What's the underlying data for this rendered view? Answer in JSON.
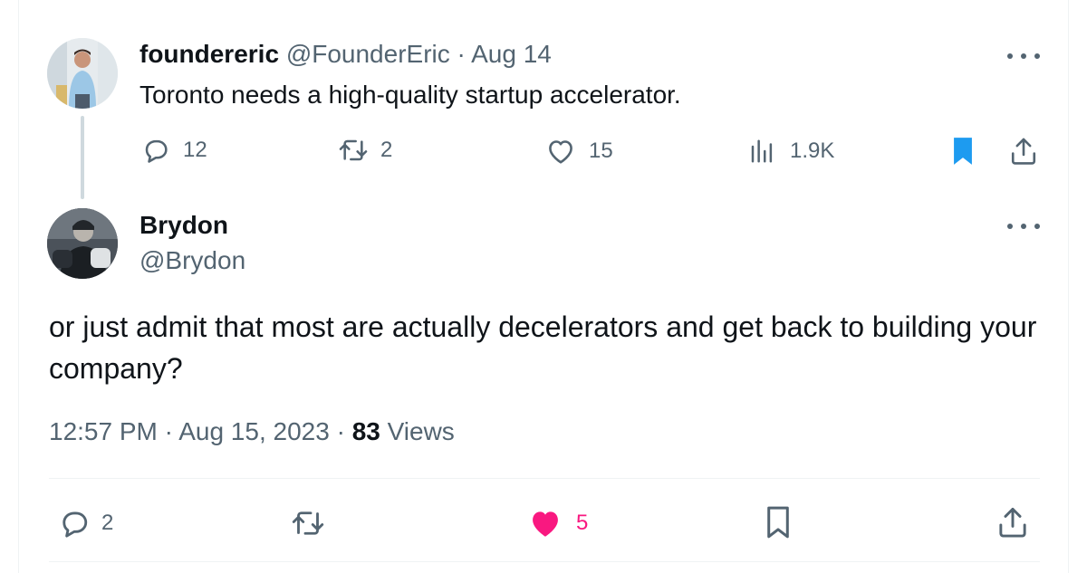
{
  "parent_tweet": {
    "display_name": "foundereric",
    "handle": "@FounderEric",
    "separator": "·",
    "date": "Aug 14",
    "text": "Toronto needs a high-quality startup accelerator.",
    "actions": {
      "replies": "12",
      "reposts": "2",
      "likes": "15",
      "views": "1.9K"
    },
    "bookmarked": true
  },
  "main_tweet": {
    "display_name": "Brydon",
    "handle": "@Brydon",
    "text": "or just admit that most are actually decelerators and get back to building your company?",
    "time": "12:57 PM",
    "separator1": "·",
    "date": "Aug 15, 2023",
    "separator2": "·",
    "views_count": "83",
    "views_label": "Views",
    "actions": {
      "replies": "2",
      "likes": "5"
    },
    "liked": true
  },
  "icons": {
    "reply": "speech-bubble-icon",
    "repost": "repost-arrows-icon",
    "like": "heart-icon",
    "views": "bar-chart-icon",
    "bookmark": "bookmark-icon",
    "share": "share-upload-icon",
    "more": "ellipsis-icon"
  },
  "colors": {
    "text_primary": "#0f1419",
    "text_secondary": "#536471",
    "bookmark_active": "#1d9bf0",
    "like_active": "#f91880",
    "thread_line": "#cfd9de",
    "divider": "#eff3f4"
  }
}
